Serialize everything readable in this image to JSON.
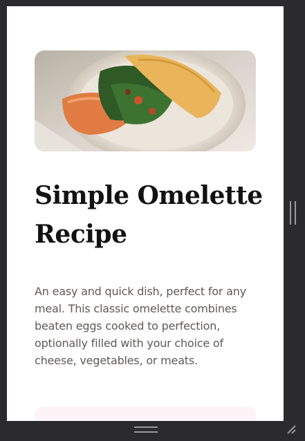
{
  "recipe": {
    "image_alt": "Omelette with spinach and sweet potato on a plate",
    "title": "Simple Omelette Recipe",
    "description": "An easy and quick dish, perfect for any meal. This classic omelette combines beaten eggs cooked to perfection, optionally filled with your choice of cheese, vegetables, or meats."
  },
  "colors": {
    "frame": "#2b2b2d",
    "page": "#ffffff",
    "title": "#121212",
    "body_text": "#5e5a58",
    "card_tint": "#fdf4f7"
  }
}
